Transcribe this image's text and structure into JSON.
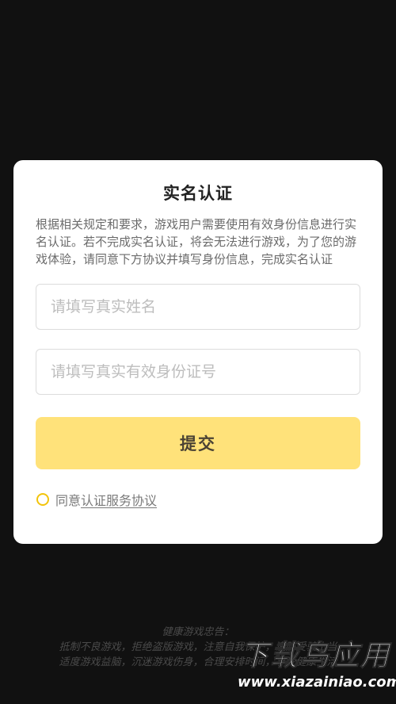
{
  "dialog": {
    "title": "实名认证",
    "description": "根据相关规定和要求，游戏用户需要使用有效身份信息进行实名认证。若不完成实名认证，将会无法进行游戏，为了您的游戏体验，请同意下方协议并填写身份信息，完成实名认证",
    "name_placeholder": "请填写真实姓名",
    "id_placeholder": "请填写真实有效身份证号",
    "submit_label": "提交",
    "agree_prefix": "同意",
    "agree_link": "认证服务协议"
  },
  "health_notice": {
    "title": "健康游戏忠告：",
    "line1": "抵制不良游戏，拒绝盗版游戏，注意自我保护，谨防受骗上当",
    "line2": "适度游戏益脑，沉迷游戏伤身，合理安排时间，享受健康生活"
  },
  "watermark": {
    "title": "下载鸟应用",
    "url": "www.xiazainiao.com"
  },
  "colors": {
    "accent": "#ffe27a",
    "radio_border": "#f2c40c",
    "background": "#111111"
  }
}
